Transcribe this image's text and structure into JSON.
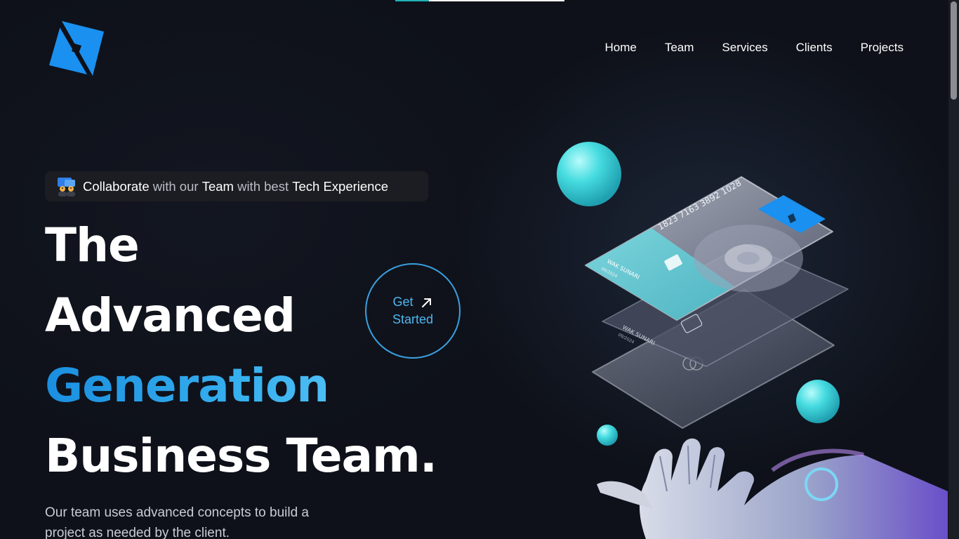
{
  "nav": {
    "items": [
      "Home",
      "Team",
      "Services",
      "Clients",
      "Projects"
    ]
  },
  "badge": {
    "icon": "team-icon",
    "parts": [
      {
        "text": "Collaborate",
        "style": "highlight"
      },
      {
        "text": " with our ",
        "style": "muted"
      },
      {
        "text": "Team",
        "style": "highlight"
      },
      {
        "text": " with best ",
        "style": "muted"
      },
      {
        "text": "Tech Experience",
        "style": "highlight"
      }
    ]
  },
  "hero": {
    "title_lines": [
      "The",
      "Advanced",
      "Generation",
      "Business Team."
    ],
    "description": "Our team uses advanced concepts to build a project as needed by the client."
  },
  "cta": {
    "line1": "Get",
    "line2": "Started",
    "icon": "arrow-up-right-icon"
  },
  "cards": {
    "number": "1823 7163 3892 1028",
    "holder": "WAK SUNARI",
    "expiry": "09/2024"
  },
  "colors": {
    "background": "#0e1119",
    "accent_blue": "#1a8fe0",
    "accent_light_blue": "#4fb6ef",
    "accent_teal": "#1fb3b8",
    "logo_blue": "#1a90f0",
    "sphere": "#46dce0"
  }
}
